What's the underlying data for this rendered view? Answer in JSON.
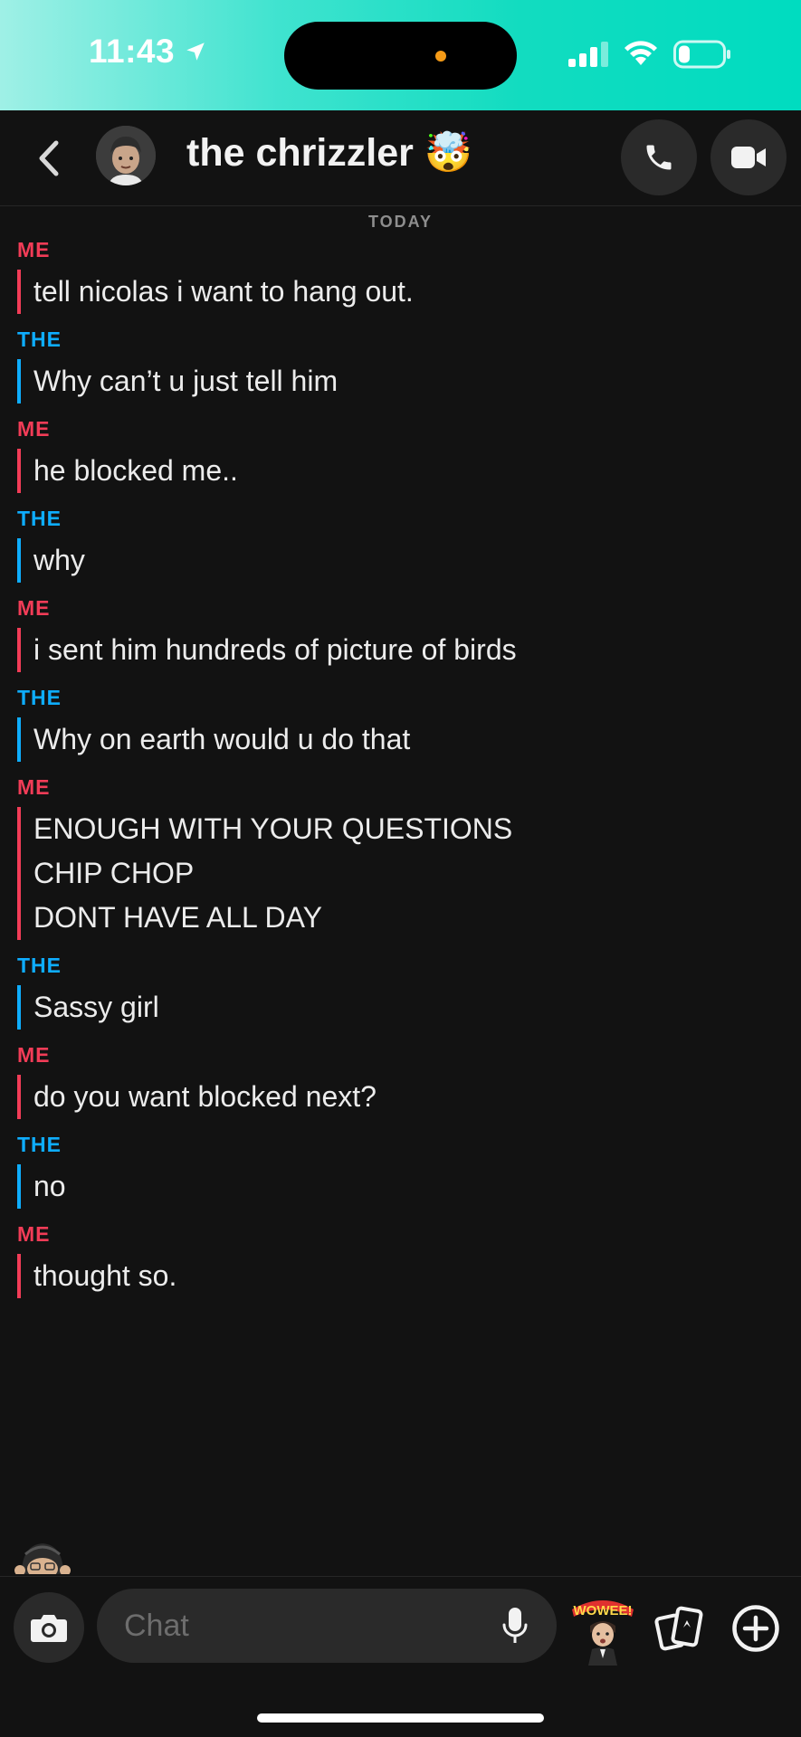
{
  "status_bar": {
    "time": "11:43",
    "icons": [
      "location-arrow-icon",
      "signal-icon",
      "wifi-icon",
      "battery-icon"
    ]
  },
  "header": {
    "contact_name": "the chrizzler",
    "contact_emoji": "🤯",
    "icons": [
      "back-chevron-icon",
      "avatar",
      "phone-icon",
      "video-icon"
    ]
  },
  "chat": {
    "date_divider": "TODAY",
    "messages": [
      {
        "sender": "ME",
        "side": "me",
        "lines": [
          "tell nicolas i want to hang out."
        ]
      },
      {
        "sender": "THE",
        "side": "them",
        "lines": [
          "Why can’t u just tell him"
        ]
      },
      {
        "sender": "ME",
        "side": "me",
        "lines": [
          "he blocked me.."
        ]
      },
      {
        "sender": "THE",
        "side": "them",
        "lines": [
          "why"
        ]
      },
      {
        "sender": "ME",
        "side": "me",
        "lines": [
          "i sent him hundreds of picture of birds"
        ]
      },
      {
        "sender": "THE",
        "side": "them",
        "lines": [
          "Why on earth would u do that"
        ]
      },
      {
        "sender": "ME",
        "side": "me",
        "lines": [
          "ENOUGH WITH YOUR QUESTIONS",
          "CHIP CHOP",
          "DONT HAVE ALL DAY"
        ]
      },
      {
        "sender": "THE",
        "side": "them",
        "lines": [
          "Sassy girl"
        ]
      },
      {
        "sender": "ME",
        "side": "me",
        "lines": [
          "do you want blocked next?"
        ]
      },
      {
        "sender": "THE",
        "side": "them",
        "lines": [
          "no"
        ]
      },
      {
        "sender": "ME",
        "side": "me",
        "lines": [
          "thought so."
        ]
      }
    ]
  },
  "composer": {
    "placeholder": "Chat",
    "icons": [
      "camera-icon",
      "microphone-icon",
      "bitmoji-sticker-icon",
      "cards-icon",
      "plus-circle-icon"
    ]
  },
  "colors": {
    "me": "#f23c57",
    "them": "#0eadff",
    "background": "#121212"
  }
}
